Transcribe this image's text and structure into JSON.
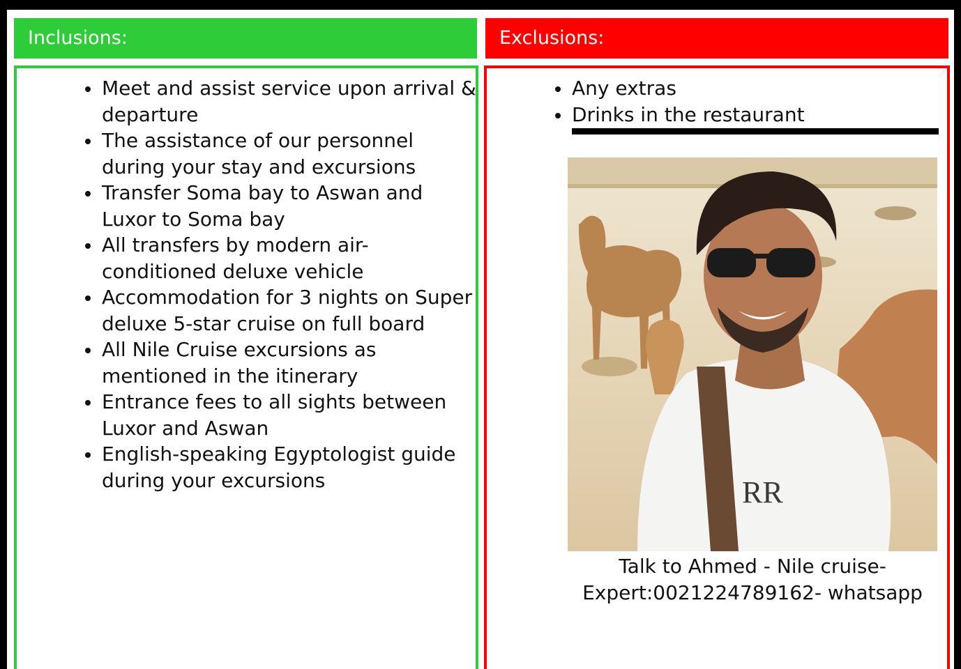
{
  "inclusions": {
    "title": "Inclusions:",
    "items": [
      "Meet and assist service upon arrival & departure",
      "The assistance of our personnel during your stay and excursions",
      "Transfer Soma bay to Aswan and Luxor to Soma bay",
      "All transfers by modern air-conditioned deluxe vehicle",
      "Accommodation for 3 nights on Super deluxe 5-star cruise on full board",
      "All Nile Cruise excursions as mentioned in the itinerary",
      "Entrance fees to all sights between Luxor and Aswan",
      "English-speaking Egyptologist guide during your excursions"
    ]
  },
  "exclusions": {
    "title": "Exclusions:",
    "items": [
      "Any extras",
      "Drinks in the restaurant"
    ]
  },
  "contact": {
    "photo_logo_text": "RR",
    "caption_line1": "Talk to Ahmed - Nile cruise-",
    "caption_line2": "Expert:0021224789162- whatsapp"
  },
  "colors": {
    "inclusions_accent": "#2ecc38",
    "exclusions_accent": "#ff0000",
    "border": "#000000"
  }
}
